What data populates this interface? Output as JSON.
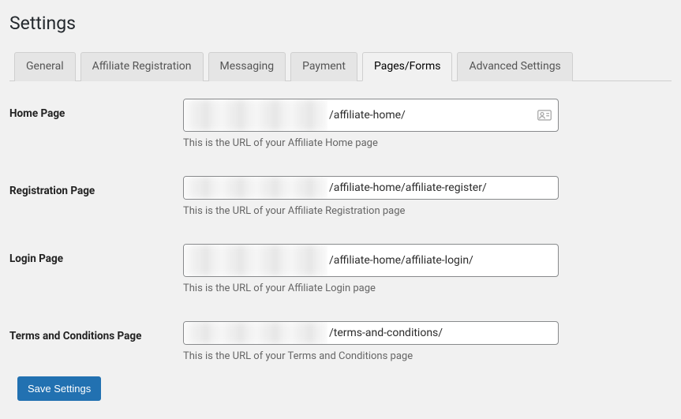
{
  "page": {
    "title": "Settings"
  },
  "tabs": {
    "general": {
      "label": "General"
    },
    "affreg": {
      "label": "Affiliate Registration"
    },
    "msg": {
      "label": "Messaging"
    },
    "pay": {
      "label": "Payment"
    },
    "pages": {
      "label": "Pages/Forms"
    },
    "adv": {
      "label": "Advanced Settings"
    }
  },
  "fields": {
    "home": {
      "label": "Home Page",
      "value": "/affiliate-home/",
      "hint": "This is the URL of your Affiliate Home page"
    },
    "register": {
      "label": "Registration Page",
      "value": "/affiliate-home/affiliate-register/",
      "hint": "This is the URL of your Affiliate Registration page"
    },
    "login": {
      "label": "Login Page",
      "value": "/affiliate-home/affiliate-login/",
      "hint": "This is the URL of your Affiliate Login page"
    },
    "terms": {
      "label": "Terms and Conditions Page",
      "value": "/terms-and-conditions/",
      "hint": "This is the URL of your Terms and Conditions page"
    }
  },
  "actions": {
    "save_label": "Save Settings"
  }
}
